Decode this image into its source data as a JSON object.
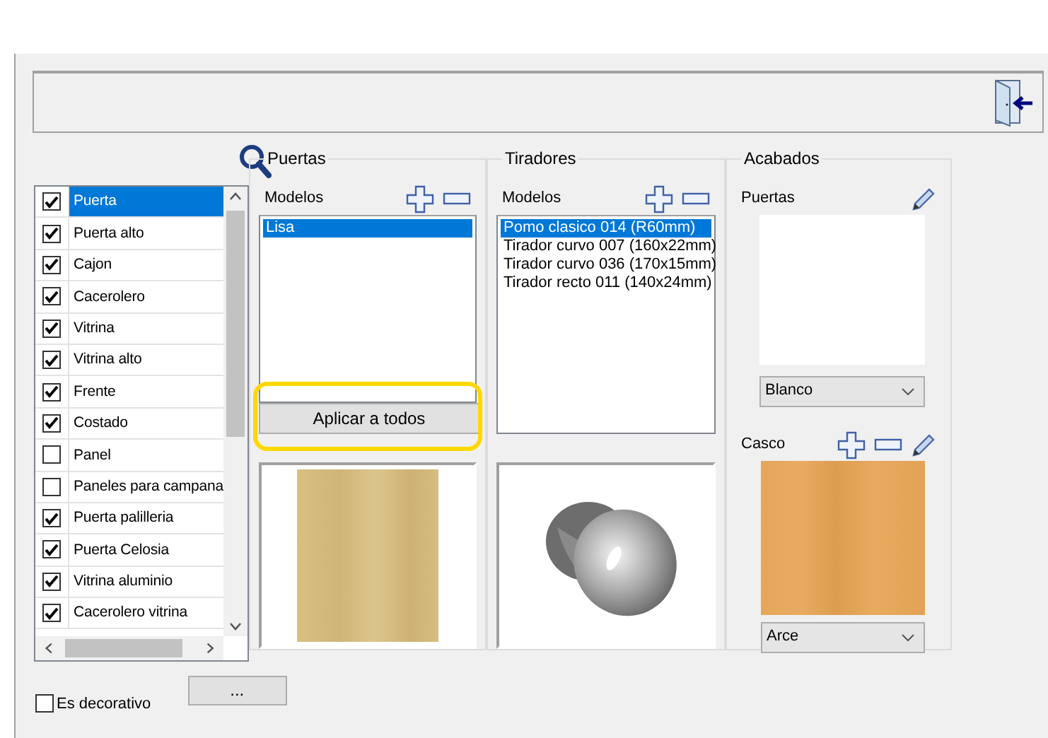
{
  "element_list": {
    "items": [
      {
        "label": "Puerta",
        "checked": true,
        "selected": true
      },
      {
        "label": "Puerta alto",
        "checked": true,
        "selected": false
      },
      {
        "label": "Cajon",
        "checked": true,
        "selected": false
      },
      {
        "label": "Cacerolero",
        "checked": true,
        "selected": false
      },
      {
        "label": "Vitrina",
        "checked": true,
        "selected": false
      },
      {
        "label": "Vitrina alto",
        "checked": true,
        "selected": false
      },
      {
        "label": "Frente",
        "checked": true,
        "selected": false
      },
      {
        "label": "Costado",
        "checked": true,
        "selected": false
      },
      {
        "label": "Panel",
        "checked": false,
        "selected": false
      },
      {
        "label": "Paneles para campana",
        "checked": false,
        "selected": false
      },
      {
        "label": "Puerta palilleria",
        "checked": true,
        "selected": false
      },
      {
        "label": "Puerta Celosia",
        "checked": true,
        "selected": false
      },
      {
        "label": "Vitrina aluminio",
        "checked": true,
        "selected": false
      },
      {
        "label": "Cacerolero vitrina",
        "checked": true,
        "selected": false
      }
    ]
  },
  "puertas": {
    "title": "Puertas",
    "models_label": "Modelos",
    "models": [
      {
        "label": "Lisa",
        "selected": true
      }
    ],
    "apply_button": "Aplicar a todos",
    "apply_highlighted": true
  },
  "tiradores": {
    "title": "Tiradores",
    "models_label": "Modelos",
    "models": [
      {
        "label": "Pomo clasico 014 (R60mm)",
        "selected": true
      },
      {
        "label": "Tirador curvo 007 (160x22mm)",
        "selected": false
      },
      {
        "label": "Tirador curvo 036 (170x15mm)",
        "selected": false
      },
      {
        "label": "Tirador recto 011 (140x24mm)",
        "selected": false
      }
    ]
  },
  "acabados": {
    "title": "Acabados",
    "puertas_label": "Puertas",
    "puertas_finish": "Blanco",
    "casco_label": "Casco",
    "casco_finish": "Arce"
  },
  "decorative": {
    "label": "Es decorativo",
    "checked": false
  },
  "more_button": "..."
}
